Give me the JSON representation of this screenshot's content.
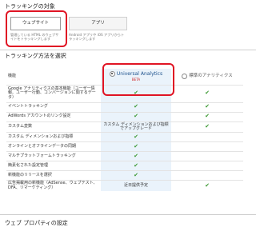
{
  "tracking_target": {
    "title": "トラッキングの対象",
    "tabs": [
      {
        "label": "ウェブサイト",
        "desc": "管理している HTML のウェブサイトをトラッキングします"
      },
      {
        "label": "アプリ",
        "desc": "Android アプリや iOS アプリからトラッキングします"
      }
    ]
  },
  "tracking_method": {
    "title": "トラッキング方法を選択",
    "col_label": "機能",
    "options": [
      {
        "label": "Universal Analytics",
        "badge": "BETA",
        "selected": true
      },
      {
        "label": "標準のアナリティクス",
        "selected": false
      }
    ],
    "rows": [
      {
        "feature": "Google アナリティクスの基本機能（ユーザー情報、ユーザー行動、コンバージョンに関するデータ）",
        "ua": "check",
        "classic": "check"
      },
      {
        "feature": "イベントトラッキング",
        "ua": "check",
        "classic": "check"
      },
      {
        "feature": "AdWords アカウントのリンク設定",
        "ua": "check",
        "classic": "check"
      },
      {
        "feature": "カスタム変数",
        "ua": "カスタム ディメンションおよび指標でアップグレード",
        "classic": "check"
      },
      {
        "feature": "カスタム ディメンションおよび指標",
        "ua": "check",
        "classic": ""
      },
      {
        "feature": "オンラインとオフラインデータの同期",
        "ua": "check",
        "classic": ""
      },
      {
        "feature": "マルチプラットフォームトラッキング",
        "ua": "check",
        "classic": ""
      },
      {
        "feature": "簡素化された設定管理",
        "ua": "check",
        "classic": ""
      },
      {
        "feature": "新機能のリリースを選択",
        "ua": "check",
        "classic": ""
      },
      {
        "feature": "広告掲載用の新機能（AdSense、ウェブテスト、DFA、リマーケティング）",
        "ua": "近日提供予定",
        "classic": "check"
      }
    ]
  },
  "web_property": {
    "title": "ウェブ プロパティの設定"
  },
  "colors": {
    "check": "#3d9a34",
    "highlight_ring": "#e01424",
    "beta": "#d01c1c"
  },
  "icons": {
    "check": "check-icon"
  }
}
